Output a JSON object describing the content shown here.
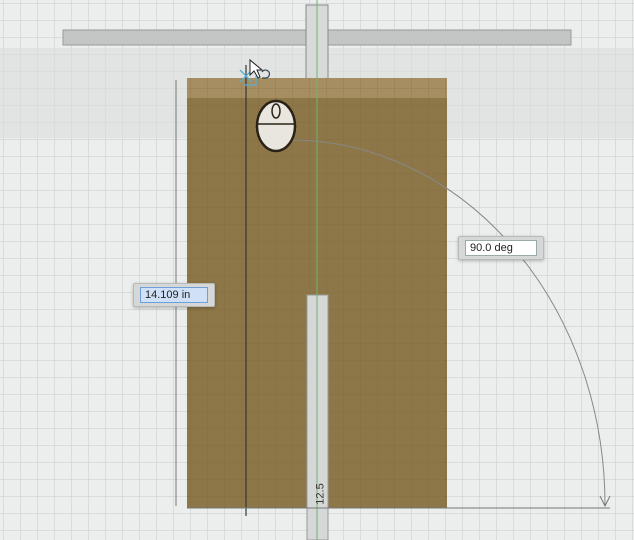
{
  "sketch": {
    "length_dimension": "14.109 in",
    "angle_dimension": "90.0 deg",
    "slot_label": "12.5"
  },
  "colors": {
    "background": "#eceeee",
    "panel": "#8d7647",
    "grid": "#c9cccc",
    "axis_green": "#6fb56f"
  },
  "icons": [
    "mouse-icon",
    "cursor-icon",
    "sketch-origin-icon"
  ]
}
